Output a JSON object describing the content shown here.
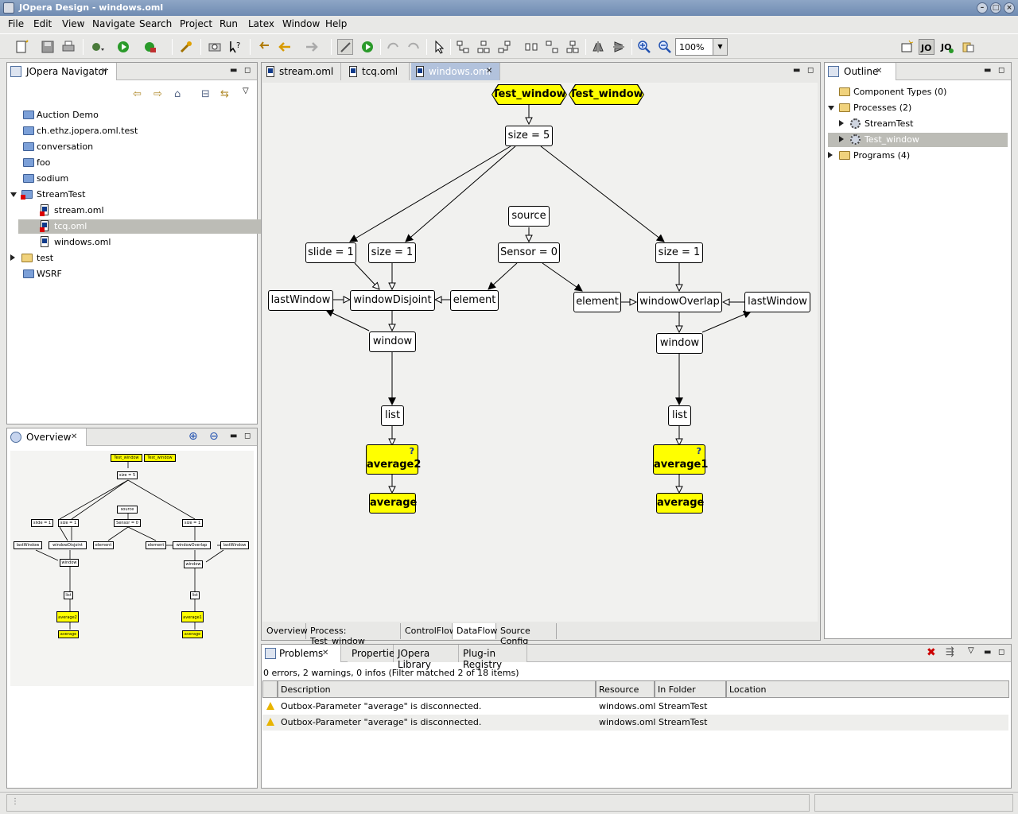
{
  "window": {
    "title": "JOpera Design - windows.oml"
  },
  "menu": [
    "File",
    "Edit",
    "View",
    "Navigate",
    "Search",
    "Project",
    "Run",
    "Latex",
    "Window",
    "Help"
  ],
  "toolbar": {
    "zoom": "100%"
  },
  "navigator": {
    "title": "JOpera Navigator",
    "items": [
      {
        "label": "Auction Demo",
        "kind": "folder"
      },
      {
        "label": "ch.ethz.jopera.oml.test",
        "kind": "folder"
      },
      {
        "label": "conversation",
        "kind": "folder"
      },
      {
        "label": "foo",
        "kind": "folder"
      },
      {
        "label": "sodium",
        "kind": "folder"
      },
      {
        "label": "StreamTest",
        "kind": "project"
      },
      {
        "label": "stream.oml",
        "kind": "file"
      },
      {
        "label": "tcq.oml",
        "kind": "file"
      },
      {
        "label": "windows.oml",
        "kind": "file"
      },
      {
        "label": "test",
        "kind": "project"
      },
      {
        "label": "WSRF",
        "kind": "folder"
      }
    ]
  },
  "overview": {
    "title": "Overview"
  },
  "editor": {
    "tabs": [
      "stream.oml",
      "tcq.oml",
      "windows.oml"
    ],
    "bottom_tabs": [
      "Overview",
      "Process: Test_window",
      "ControlFlow",
      "DataFlow",
      "Source Config"
    ],
    "nodes": {
      "input_a": "Test_window",
      "input_b": "Test_window",
      "size5": "size = 5",
      "source": "source",
      "slide1": "slide = 1",
      "size1a": "size = 1",
      "sensor0": "Sensor = 0",
      "size1b": "size = 1",
      "lastwindow_l": "lastWindow",
      "windowdisjoint": "windowDisjoint",
      "element_l": "element",
      "element_r": "element",
      "windowoverlap": "windowOverlap",
      "lastwindow_r": "lastWindow",
      "window_l": "window",
      "window_r": "window",
      "list_l": "list",
      "list_r": "list",
      "average2": "average2",
      "average1": "average1",
      "avg_out_l": "average",
      "avg_out_r": "average",
      "q_mark": "?"
    }
  },
  "outline": {
    "title": "Outline",
    "items": [
      {
        "label": "Component Types (0)"
      },
      {
        "label": "Processes (2)"
      },
      {
        "label": "StreamTest"
      },
      {
        "label": "Test_window"
      },
      {
        "label": "Programs (4)"
      }
    ]
  },
  "problems": {
    "tabs": [
      "Problems",
      "Properties",
      "JOpera Library",
      "Plug-in Registry"
    ],
    "summary": "0 errors, 2 warnings, 0 infos (Filter matched 2 of 18 items)",
    "columns": [
      "Description",
      "Resource",
      "In Folder",
      "Location"
    ],
    "rows": [
      {
        "description": "Outbox-Parameter \"average\" is disconnected.",
        "resource": "windows.oml",
        "folder": "StreamTest",
        "location": ""
      },
      {
        "description": "Outbox-Parameter \"average\" is disconnected.",
        "resource": "windows.oml",
        "folder": "StreamTest",
        "location": ""
      }
    ]
  }
}
